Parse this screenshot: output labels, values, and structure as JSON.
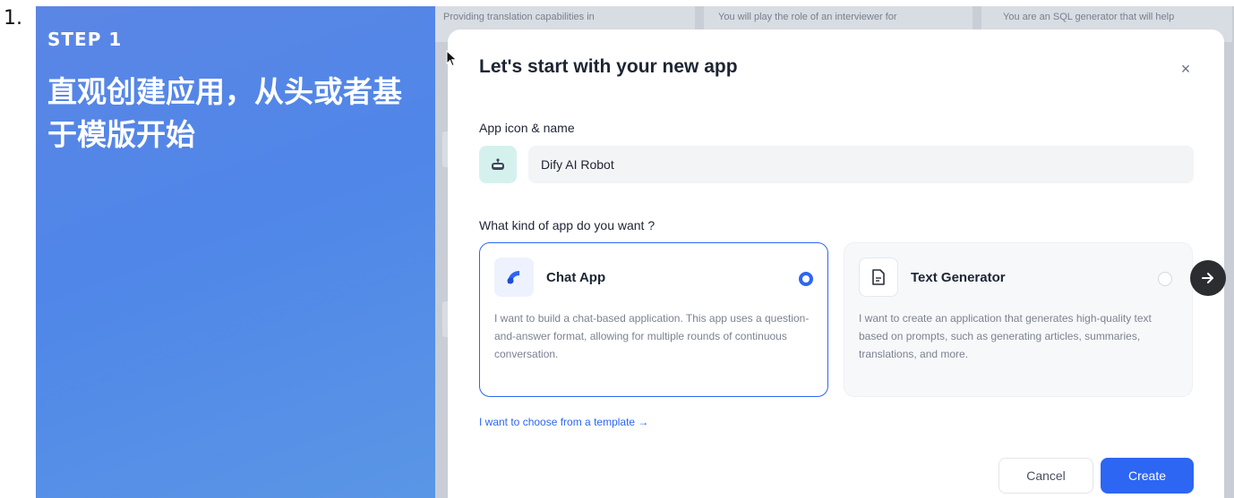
{
  "list_marker": "1.",
  "promo": {
    "step_label": "STEP 1",
    "headline": "直观创建应用，从头或者基于模版开始"
  },
  "background": {
    "cards": [
      "Providing translation capabilities in",
      "You will play the role of an interviewer for",
      "You are an SQL generator that will help"
    ]
  },
  "modal": {
    "title": "Let's start with your new app",
    "close_glyph": "×",
    "icon_name_label": "App icon & name",
    "app_icon": "robot-icon",
    "app_name_value": "Dify AI Robot",
    "kind_label": "What kind of app do you want ?",
    "types": [
      {
        "icon": "chat-bubble-icon",
        "title": "Chat App",
        "description": "I want to build a chat-based application. This app uses a question-and-answer format, allowing for multiple rounds of continuous conversation.",
        "selected": true
      },
      {
        "icon": "document-icon",
        "title": "Text Generator",
        "description": "I want to create an application that generates high-quality text based on prompts, such as generating articles, summaries, translations, and more.",
        "selected": false
      }
    ],
    "template_link": "I want to choose from a template →",
    "cancel_label": "Cancel",
    "create_label": "Create"
  },
  "colors": {
    "accent": "#2d66f2",
    "promo_blue": "#5289e6",
    "overlay_gray": "#c9ced6"
  }
}
